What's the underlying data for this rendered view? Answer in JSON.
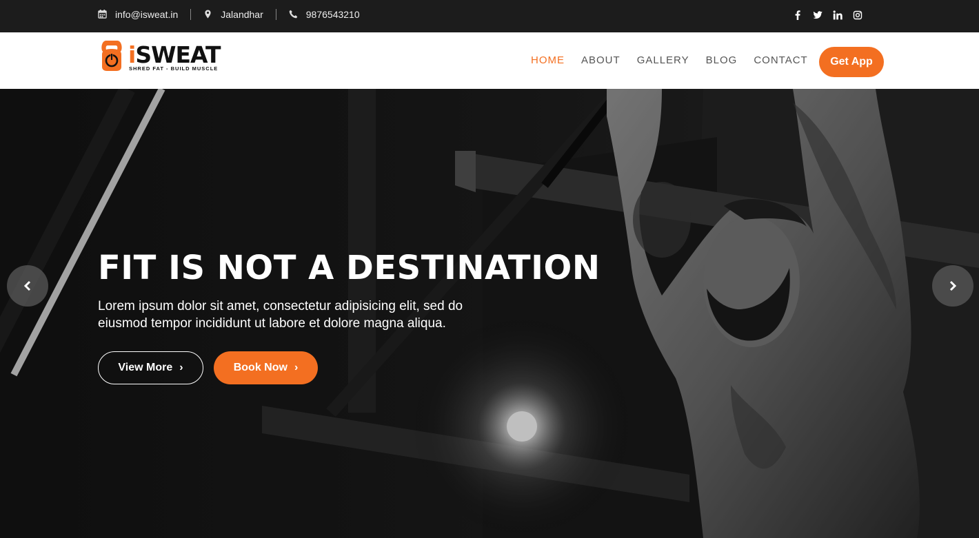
{
  "topbar": {
    "email": "info@isweat.in",
    "location": "Jalandhar",
    "phone": "9876543210",
    "social": [
      "facebook-icon",
      "twitter-icon",
      "linkedin-icon",
      "instagram-icon"
    ]
  },
  "brand": {
    "name_i": "i",
    "name_rest": "SWEAT",
    "tagline": "SHRED FAT - BUILD MUSCLE",
    "accent": "#f36f21"
  },
  "nav": {
    "items": [
      "HOME",
      "ABOUT",
      "GALLERY",
      "BLOG",
      "CONTACT"
    ],
    "active": "HOME",
    "cta": "Get App"
  },
  "hero": {
    "title": "FIT IS NOT A DESTINATION",
    "text": "Lorem ipsum dolor sit amet, consectetur adipisicing elit, sed do eiusmod tempor incididunt ut labore et dolore magna aliqua.",
    "btn_view": "View More",
    "btn_book": "Book Now",
    "chevron": "›"
  }
}
